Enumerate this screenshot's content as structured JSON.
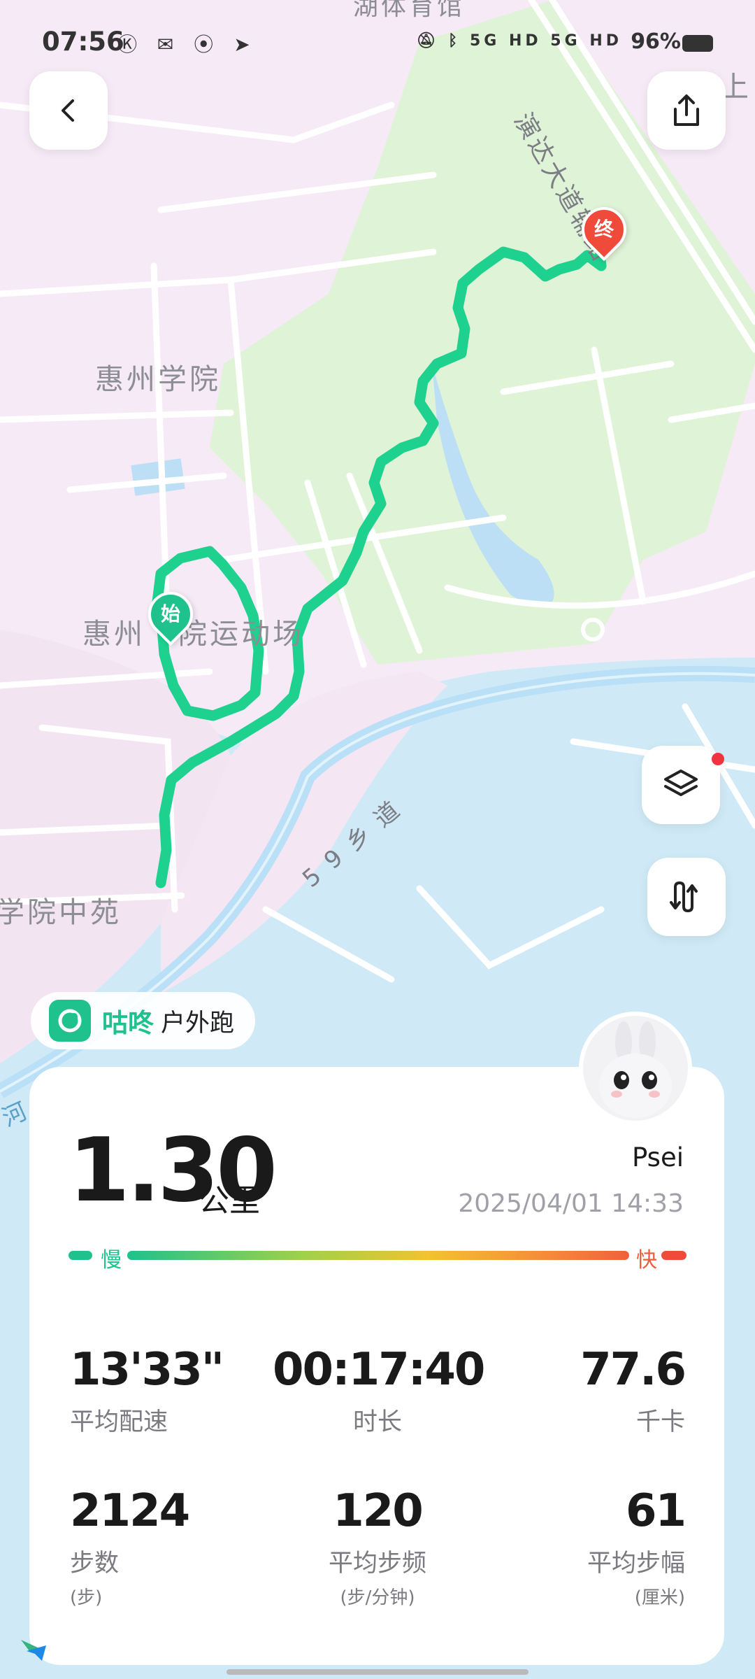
{
  "status_bar": {
    "time": "07:56",
    "left_icons": [
      "k-icon",
      "wechat-icon",
      "hotspot-icon",
      "telegram-icon"
    ],
    "right_icons_text": "5G HD 5G HD",
    "battery": "96%"
  },
  "map": {
    "labels": {
      "top": "湖体育馆",
      "university": "惠州学院",
      "sports_ground_a": "惠州",
      "sports_ground_b": "院运动场",
      "garden": "学院中苑",
      "road": "演达大道辅路",
      "village_road": "5 9 乡 道",
      "river": "河 桥 水",
      "top_right": "上"
    },
    "markers": {
      "start": "始",
      "end": "终"
    },
    "colors": {
      "route": "#1ed18f",
      "start_marker": "#1fc18c",
      "end_marker": "#f04a3a"
    }
  },
  "brand": {
    "name": "咕咚",
    "activity": "户外跑"
  },
  "summary": {
    "distance": "1.30",
    "distance_unit": "公里",
    "user": "Psei",
    "datetime": "2025/04/01 14:33",
    "pace_slow": "慢",
    "pace_fast": "快"
  },
  "stats": {
    "pace": {
      "value": "13'33\"",
      "label": "平均配速"
    },
    "duration": {
      "value": "00:17:40",
      "label": "时长"
    },
    "calories": {
      "value": "77.6",
      "label": "千卡"
    },
    "steps": {
      "value": "2124",
      "label": "步数",
      "sub": "(步)"
    },
    "cadence": {
      "value": "120",
      "label": "平均步频",
      "sub": "(步/分钟)"
    },
    "stride": {
      "value": "61",
      "label": "平均步幅",
      "sub": "(厘米)"
    }
  }
}
